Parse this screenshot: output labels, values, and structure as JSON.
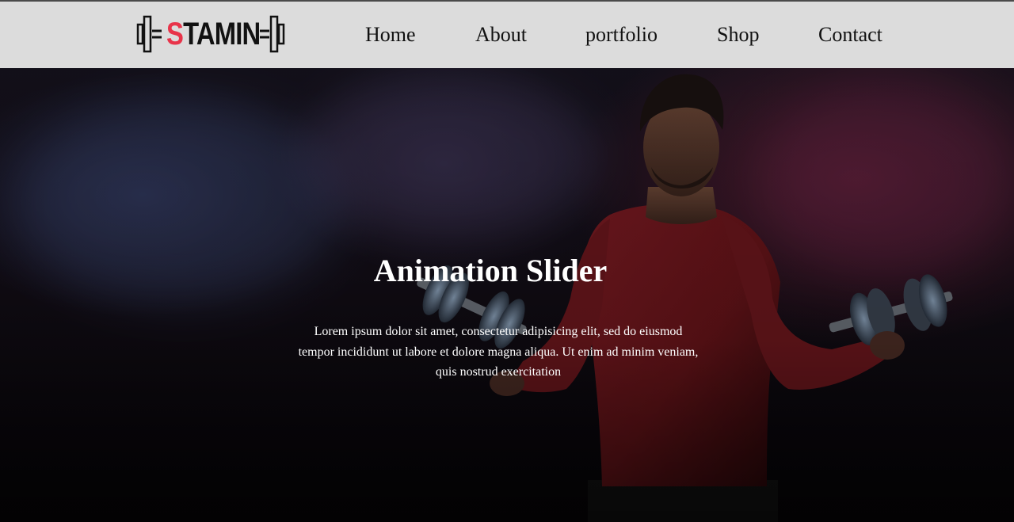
{
  "header": {
    "logo_text_accent": "S",
    "logo_text_rest": "TAMIN",
    "logo_accent_color": "#e8344a",
    "background_color": "#dcdcdc"
  },
  "nav": {
    "items": [
      {
        "label": "Home"
      },
      {
        "label": "About"
      },
      {
        "label": "portfolio"
      },
      {
        "label": "Shop"
      },
      {
        "label": "Contact"
      }
    ]
  },
  "hero": {
    "image": "athlete-with-dumbbells-photo",
    "title": "Animation Slider",
    "text": "Lorem ipsum dolor sit amet, consectetur adipisicing elit, sed do eiusmod tempor incididunt ut labore et dolore magna aliqua. Ut enim ad minim veniam, quis nostrud exercitation"
  }
}
